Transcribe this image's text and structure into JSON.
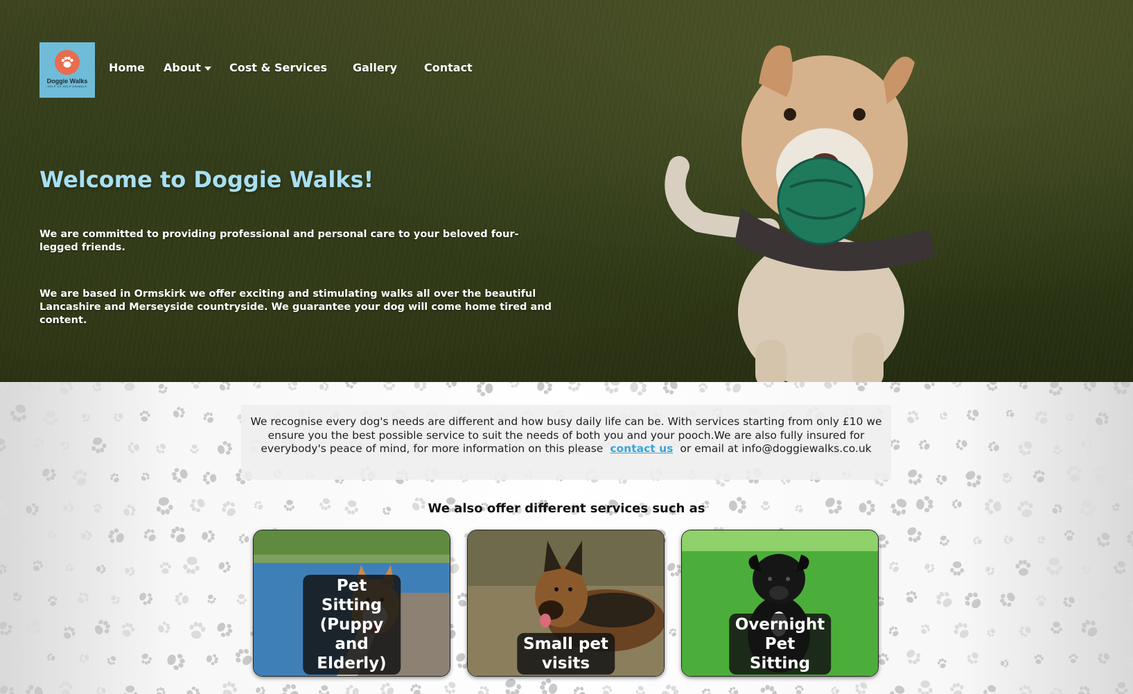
{
  "logo": {
    "name": "Doggie Walks",
    "tagline": "HELP US HELP ANIMALS"
  },
  "nav": {
    "home": "Home",
    "about": "About",
    "cost_services": "Cost & Services",
    "gallery": "Gallery",
    "contact": "Contact"
  },
  "hero": {
    "title": "Welcome to Doggie Walks!",
    "paragraph1": "We are committed to providing professional and personal care to your beloved four-legged friends.",
    "paragraph2": "We are based in Ormskirk we offer exciting and stimulating walks all over the beautiful Lancashire and Merseyside countryside. We guarantee your dog will come home tired and content."
  },
  "intro": {
    "text_before_link": "We recognise every dog's needs are different and how busy daily life can be. With services starting from only £10 we ensure you the best possible service to suit the needs of both you and your pooch.We are also fully insured for everybody's peace of mind, for more information on this please",
    "link_text": "contact us",
    "text_after_link": "or email at info@doggiewalks.co.uk"
  },
  "services": {
    "heading": "We also offer different services such as",
    "cards": [
      {
        "label": "Pet Sitting (Puppy and Elderly)"
      },
      {
        "label": "Small pet visits"
      },
      {
        "label": "Overnight Pet Sitting"
      }
    ]
  },
  "colors": {
    "hero_title": "#a8dff2",
    "logo_bg": "#6fbcd8",
    "logo_paw": "#e86d4e",
    "link": "#3aa3d6"
  },
  "icons": {
    "logo_paw": "paw-icon",
    "about_dropdown": "caret-down-icon"
  }
}
